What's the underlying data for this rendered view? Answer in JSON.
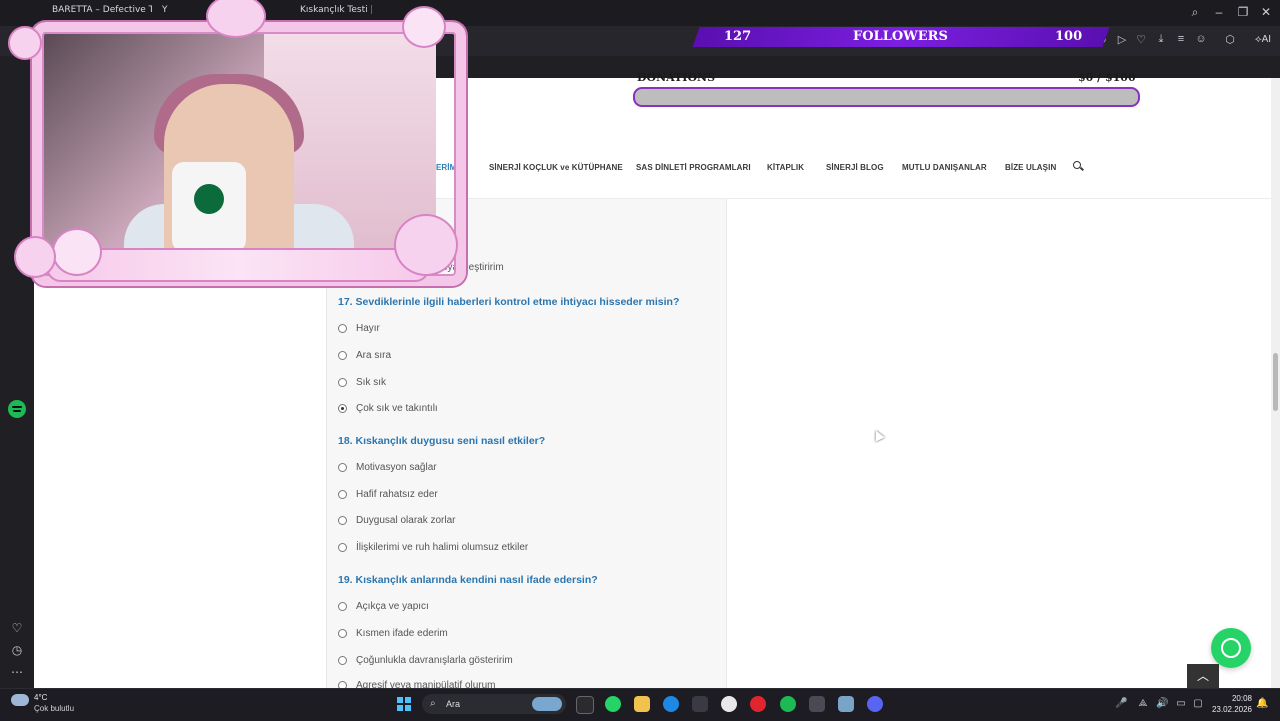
{
  "browser": {
    "tabs": [
      {
        "label": "BARETTA – Defective Trap"
      },
      {
        "label": "Y"
      },
      {
        "label": "Kıskançlık Testi | Sinerji P..."
      }
    ],
    "toolbar_icons": [
      "camera-off-icon",
      "play-icon",
      "heart-icon",
      "download-icon",
      "menu-icon",
      "profile-icon",
      "cube-icon"
    ],
    "ai_label": "AI"
  },
  "overlay": {
    "followers_left": "127",
    "followers_label": "FOLLOWERS",
    "followers_right": "100",
    "donations_label": "DONATIONS",
    "donations_amount": "$0 / $100",
    "donations_progress": 0
  },
  "site_nav": {
    "items": [
      {
        "label": "LERİMİZ",
        "active": true
      },
      {
        "label": "SİNERJİ KOÇLUK ve KÜTÜPHANE"
      },
      {
        "label": "SAS DİNLETİ PROGRAMLARI"
      },
      {
        "label": "KİTAPLIK"
      },
      {
        "label": "SİNERJİ BLOG"
      },
      {
        "label": "MUTLU DANIŞANLAR"
      },
      {
        "label": "BİZE ULAŞIN"
      }
    ]
  },
  "quiz": {
    "partial_option": "veya eleştiririm",
    "questions": [
      {
        "title": "17. Sevdiklerinle ilgili haberleri kontrol etme ihtiyacı hisseder misin?",
        "options": [
          {
            "label": "Hayır",
            "checked": false
          },
          {
            "label": "Ara sıra",
            "checked": false
          },
          {
            "label": "Sık sık",
            "checked": false
          },
          {
            "label": "Çok sık ve takıntılı",
            "checked": true
          }
        ]
      },
      {
        "title": "18. Kıskançlık duygusu seni nasıl etkiler?",
        "options": [
          {
            "label": "Motivasyon sağlar",
            "checked": false
          },
          {
            "label": "Hafif rahatsız eder",
            "checked": false
          },
          {
            "label": "Duygusal olarak zorlar",
            "checked": false
          },
          {
            "label": "İlişkilerimi ve ruh halimi olumsuz etkiler",
            "checked": false
          }
        ]
      },
      {
        "title": "19. Kıskançlık anlarında kendini nasıl ifade edersin?",
        "options": [
          {
            "label": "Açıkça ve yapıcı",
            "checked": false
          },
          {
            "label": "Kısmen ifade ederim",
            "checked": false
          },
          {
            "label": "Çoğunlukla davranışlarla gösteririm",
            "checked": false
          },
          {
            "label": "Agresif veya manipülatif olurum",
            "checked": false
          }
        ]
      }
    ]
  },
  "taskbar": {
    "weather_temp": "4°C",
    "weather_desc": "Çok bulutlu",
    "search_label": "Ara",
    "time": "20:08",
    "date": "23.02.2026"
  }
}
